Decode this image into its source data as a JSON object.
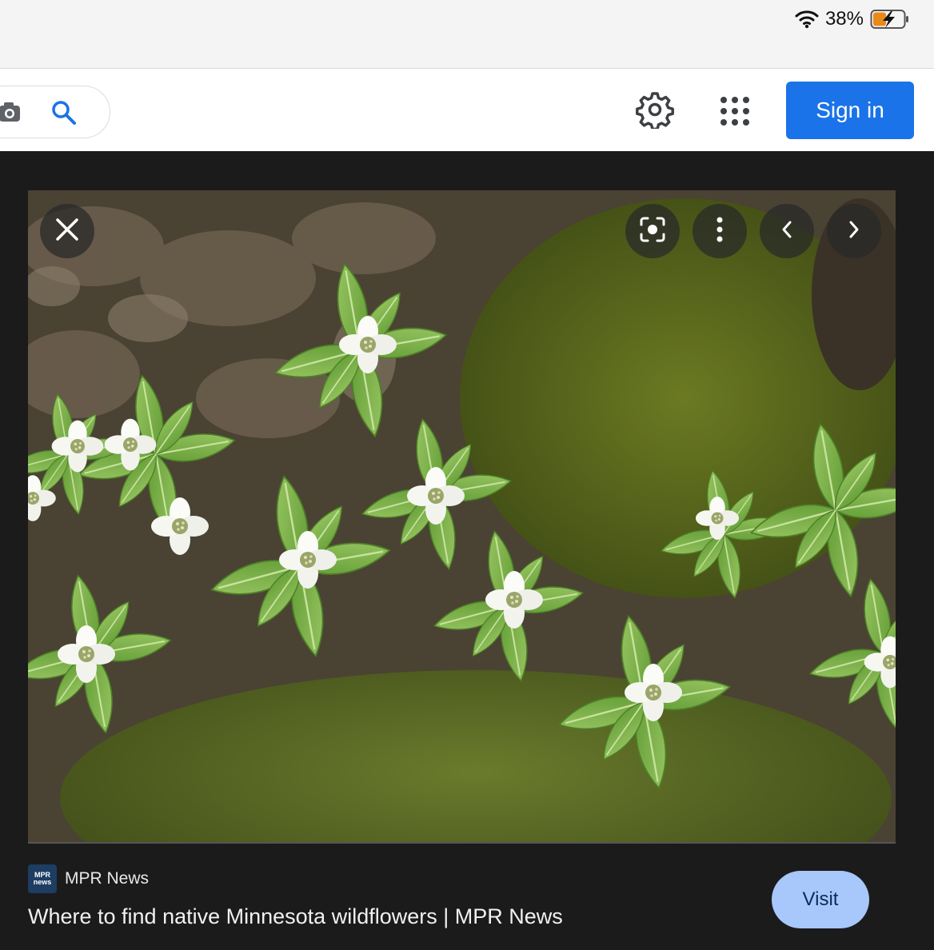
{
  "status_bar": {
    "battery_percent": "38%",
    "icons": [
      "wifi-icon",
      "battery-charging-icon"
    ]
  },
  "header": {
    "search_icons": [
      "camera-icon",
      "search-icon"
    ],
    "settings_icon": "gear-icon",
    "apps_icon": "apps-grid-icon",
    "sign_in_label": "Sign in",
    "accent_color": "#1a73e8"
  },
  "viewer": {
    "controls": [
      "close-icon",
      "lens-icon",
      "more-vert-icon",
      "chevron-left-icon",
      "chevron-right-icon"
    ],
    "source": {
      "logo_text": "MPR news",
      "name": "MPR News"
    },
    "title": "Where to find native Minnesota wildflowers | MPR News",
    "visit_label": "Visit",
    "visit_color": "#a8c7fa"
  }
}
